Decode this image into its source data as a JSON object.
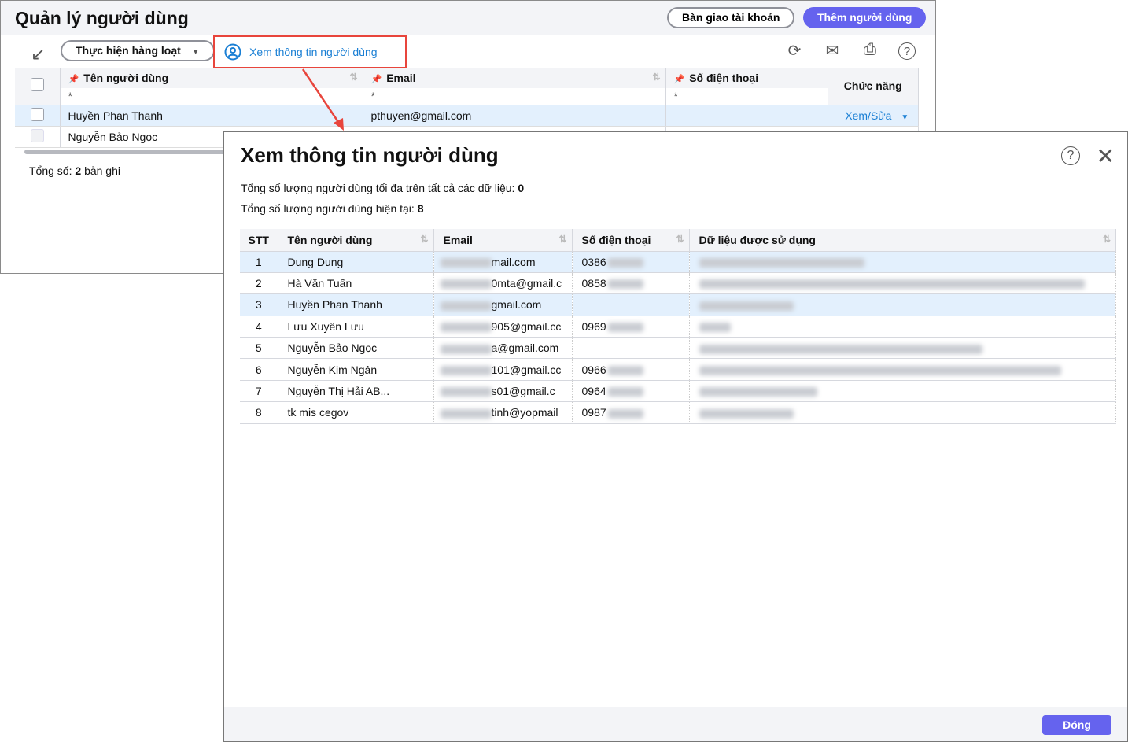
{
  "main": {
    "title": "Quản lý người dùng",
    "handover_label": "Bàn giao tài khoản",
    "add_user_label": "Thêm người dùng",
    "bulk_label": "Thực hiện hàng loạt",
    "view_user_label": "Xem thông tin người dùng",
    "columns": {
      "name": "Tên người dùng",
      "email": "Email",
      "phone": "Số điện thoại",
      "actions": "Chức năng"
    },
    "filter_symbol": "*",
    "rows": [
      {
        "name": "Huyền Phan Thanh",
        "email": "pthuyen@gmail.com",
        "phone": "",
        "action": "Xem/Sửa"
      },
      {
        "name": "Nguyễn Bảo Ngọc",
        "email": "",
        "phone": "",
        "action": ""
      }
    ],
    "total_label": "Tổng số:",
    "total_count": "2",
    "total_suffix": "bản ghi"
  },
  "dialog": {
    "title": "Xem thông tin người dùng",
    "max_label": "Tổng số lượng người dùng tối đa trên tất cả các dữ liệu:",
    "max_value": "0",
    "current_label": "Tổng số lượng người dùng hiện tại:",
    "current_value": "8",
    "columns": {
      "stt": "STT",
      "name": "Tên người dùng",
      "email": "Email",
      "phone": "Số điện thoại",
      "data": "Dữ liệu được sử dụng"
    },
    "rows": [
      {
        "stt": "1",
        "name": "Dung Dung",
        "email": "mail.com",
        "phone": "0386"
      },
      {
        "stt": "2",
        "name": "Hà Văn Tuấn",
        "email": "0mta@gmail.c",
        "phone": "0858"
      },
      {
        "stt": "3",
        "name": "Huyền Phan Thanh",
        "email": "gmail.com",
        "phone": ""
      },
      {
        "stt": "4",
        "name": "Lưu Xuyên Lưu",
        "email": "905@gmail.cc",
        "phone": "0969"
      },
      {
        "stt": "5",
        "name": "Nguyễn Bảo Ngọc",
        "email": "a@gmail.com",
        "phone": ""
      },
      {
        "stt": "6",
        "name": "Nguyễn Kim Ngân",
        "email": "101@gmail.cc",
        "phone": "0966"
      },
      {
        "stt": "7",
        "name": "Nguyễn Thị Hải AB...",
        "email": "s01@gmail.c",
        "phone": "0964"
      },
      {
        "stt": "8",
        "name": "tk mis cegov",
        "email": "tinh@yopmail",
        "phone": "0987"
      }
    ],
    "close_label": "Đóng"
  },
  "colors": {
    "primary": "#6563ee",
    "link": "#1a7fd4",
    "highlight": "#e8453c",
    "selected_row": "#e3f0fd"
  }
}
